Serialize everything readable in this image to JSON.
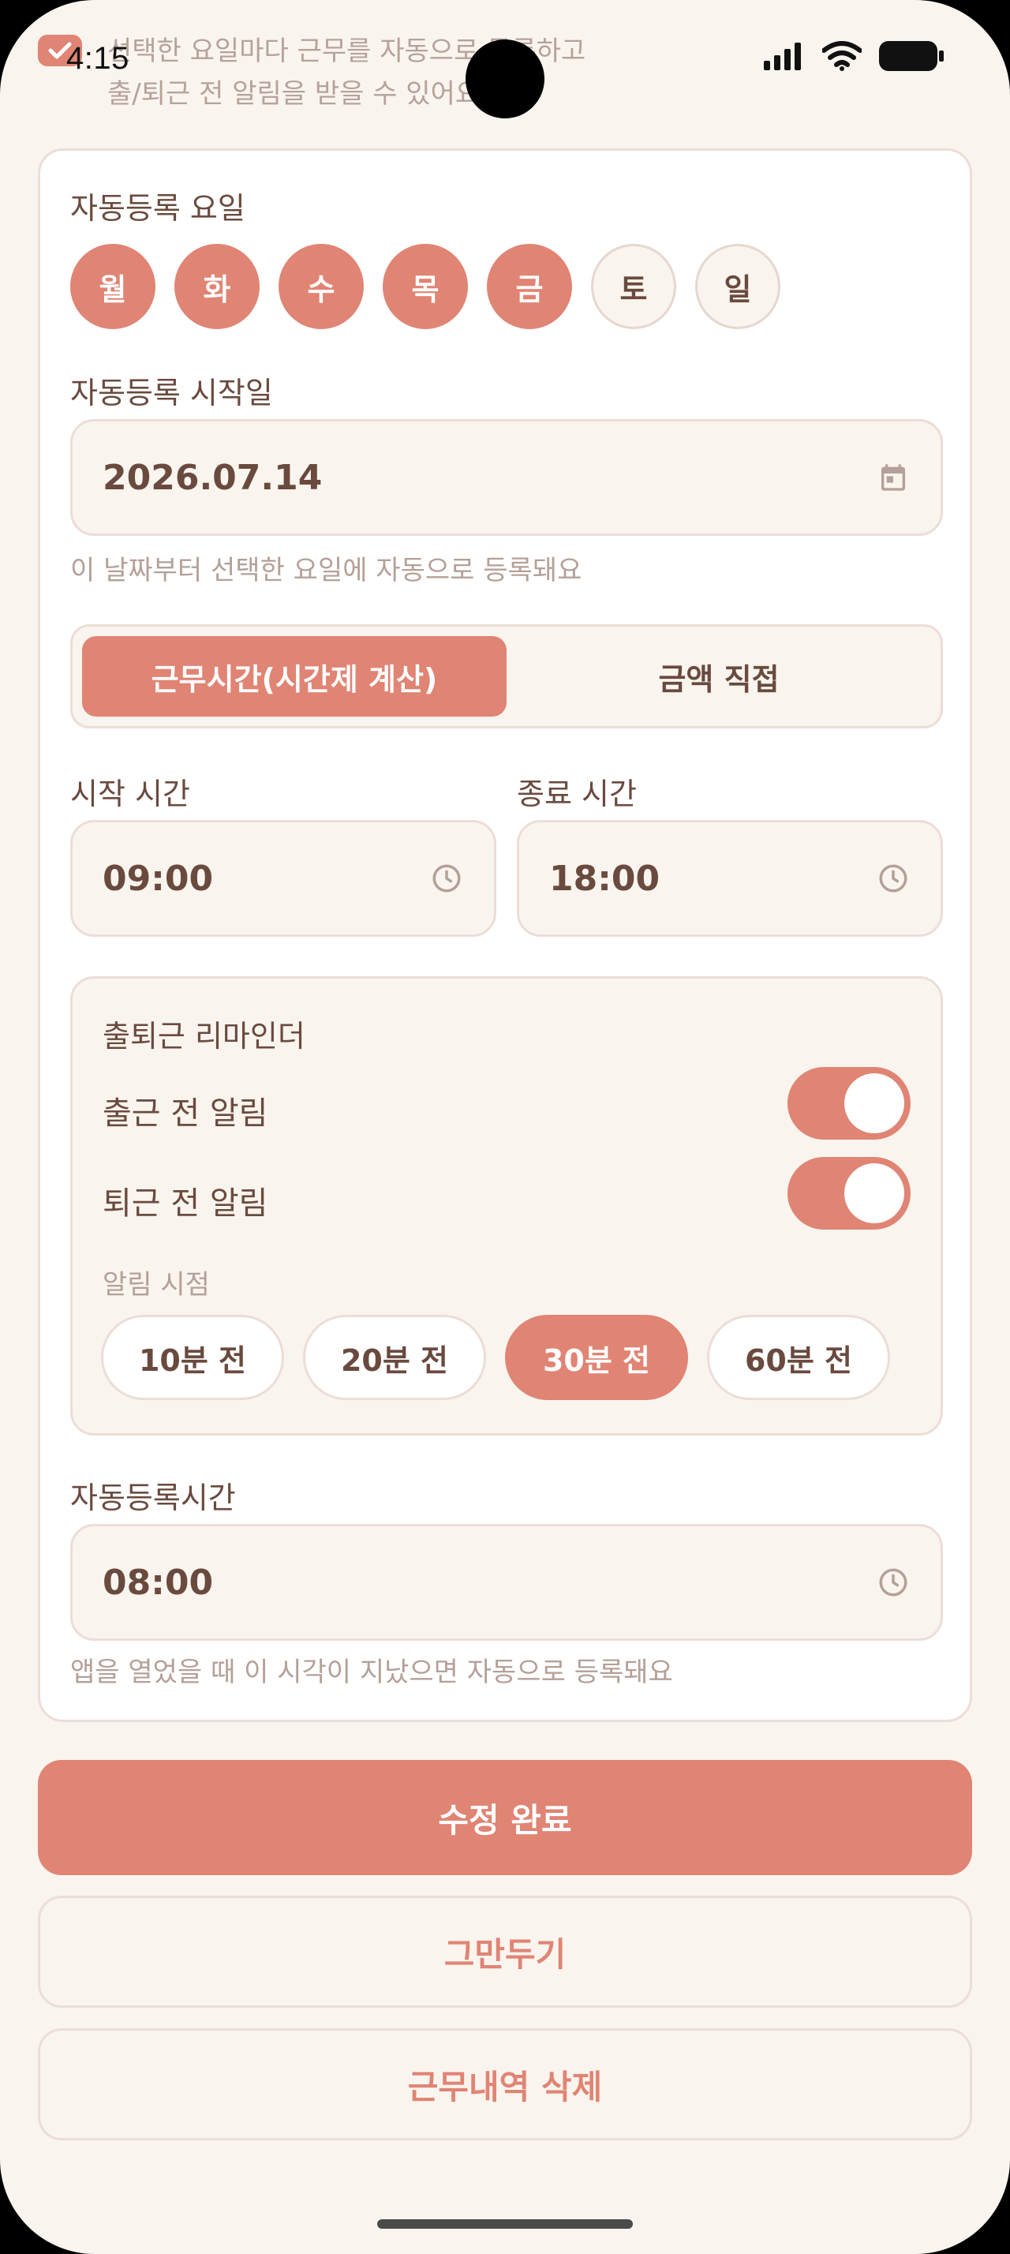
{
  "status_bar": {
    "time": "4:15"
  },
  "header": {
    "description_line1": "선택한 요일마다 근무를 자동으로 등록하고",
    "description_line2": "출/퇴근 전 알림을 받을 수 있어요"
  },
  "auto_register": {
    "days_label": "자동등록 요일",
    "days": [
      {
        "label": "월",
        "selected": true
      },
      {
        "label": "화",
        "selected": true
      },
      {
        "label": "수",
        "selected": true
      },
      {
        "label": "목",
        "selected": true
      },
      {
        "label": "금",
        "selected": true
      },
      {
        "label": "토",
        "selected": false
      },
      {
        "label": "일",
        "selected": false
      }
    ],
    "start_date_label": "자동등록 시작일",
    "start_date_value": "2026.07.14",
    "start_date_hint": "이 날짜부터 선택한 요일에 자동으로 등록돼요"
  },
  "pay_mode": {
    "options": [
      "근무시간(시간제 계산)",
      "금액 직접"
    ],
    "selected": "근무시간(시간제 계산)"
  },
  "time": {
    "start_label": "시작 시간",
    "start_value": "09:00",
    "end_label": "종료 시간",
    "end_value": "18:00"
  },
  "reminder": {
    "title": "출퇴근 리마인더",
    "clock_in_label": "출근 전 알림",
    "clock_in_enabled": true,
    "clock_out_label": "퇴근 전 알림",
    "clock_out_enabled": true,
    "timing_label": "알림 시점",
    "timing_options": [
      "10분 전",
      "20분 전",
      "30분 전",
      "60분 전"
    ],
    "timing_selected": "30분 전"
  },
  "auto_register_time": {
    "label": "자동등록시간",
    "value": "08:00",
    "hint": "앱을 열었을 때 이 시각이 지났으면 자동으로 등록돼요"
  },
  "actions": {
    "save": "수정 완료",
    "cancel": "그만두기",
    "delete": "근무내역 삭제"
  },
  "colors": {
    "accent": "#e08474",
    "background": "#f9f4ee",
    "text": "#6a4a3e",
    "muted": "#b4a098",
    "border": "#ecddd6"
  }
}
